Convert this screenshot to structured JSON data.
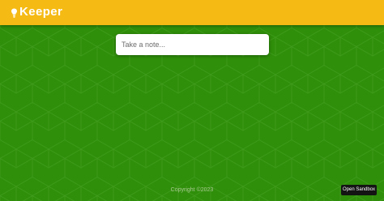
{
  "colors": {
    "header_bg": "#f5ba13",
    "page_bg": "#2f8f0a",
    "pattern_line": "#3f9b1c",
    "footer_text": "#a6c98f",
    "sandbox_bg": "#141414"
  },
  "header": {
    "logo_icon": "lightbulb-icon",
    "title": "Keeper"
  },
  "note_form": {
    "placeholder": "Take a note..."
  },
  "footer": {
    "copyright": "Copyright ©2023"
  },
  "sandbox": {
    "label": "Open Sandbox"
  }
}
